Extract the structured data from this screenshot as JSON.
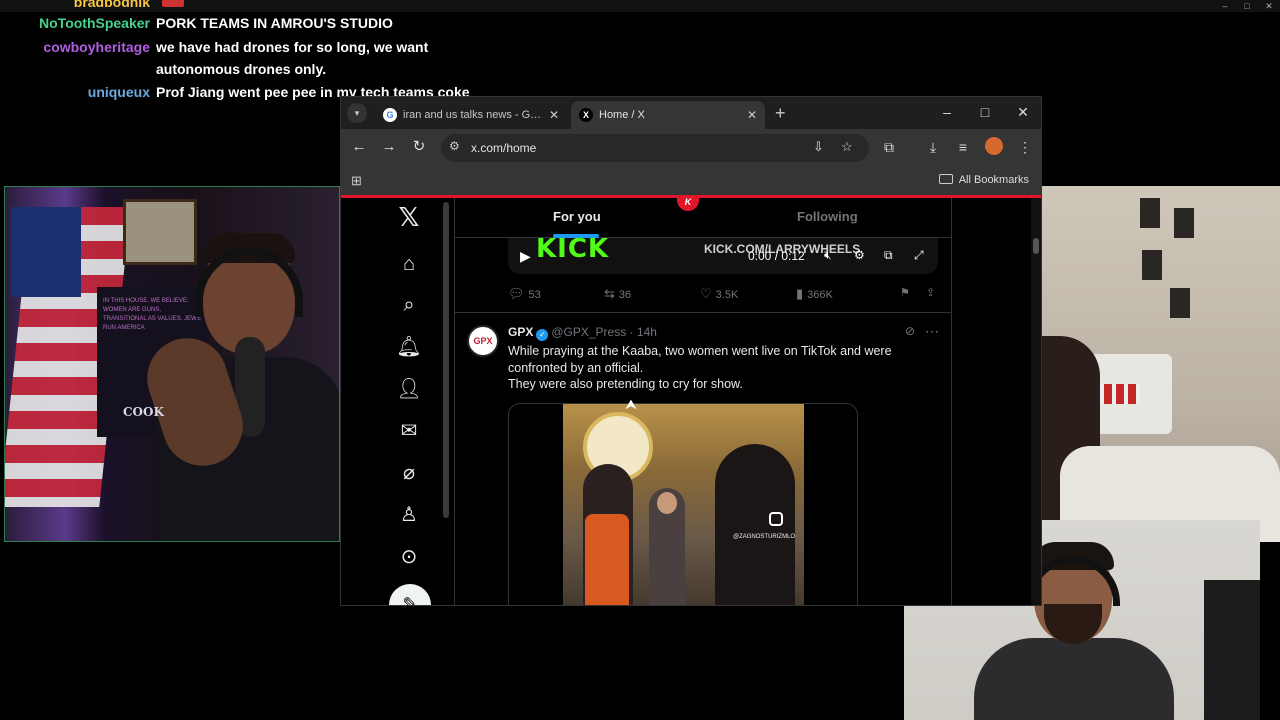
{
  "chat": [
    {
      "user": "bradbodnik",
      "message": "",
      "color": "#f5c542"
    },
    {
      "user": "NoToothSpeaker",
      "message": "PORK TEAMS IN AMROU'S STUDIO",
      "color": "#47d18c"
    },
    {
      "user": "cowboyheritage",
      "message": "we have had drones for so long, we want",
      "message2": "autonomous drones only.",
      "color": "#b05fe0"
    },
    {
      "user": "uniqueux",
      "message": "Prof Jiang went pee pee in my tech teams coke",
      "color": "#6fa8dc"
    }
  ],
  "webcam_left": {
    "shirt_text": "COOK",
    "poster_text": "IN THIS HOUSE, WE BELIEVE: WOMEN ARE GUNS, TRANSITIONAL AS VALUES, JEWS RUN AMERICA"
  },
  "browser": {
    "tabs": [
      {
        "title": "iran and us talks news - Google",
        "favicon": "G",
        "favicon_color": "#4285f4"
      },
      {
        "title": "Home / X",
        "favicon": "X",
        "favicon_color": "#ffffff"
      }
    ],
    "url": "x.com/home",
    "all_bookmarks": "All Bookmarks"
  },
  "x": {
    "tabs": {
      "for_you": "For you",
      "following": "Following"
    },
    "video": {
      "logo": "KICK",
      "url": "KICK.COM/LARRYWHEELS",
      "time": "0:00 / 0:12"
    },
    "actions": {
      "replies": "53",
      "reposts": "36",
      "likes": "3.5K",
      "views": "366K"
    },
    "tweet": {
      "name": "GPX",
      "handle": "@GPX_Press",
      "time": "14h",
      "avatar_text": "GPX",
      "text1": "While praying at the Kaaba, two women went live on TikTok and were confronted by an official.",
      "text2": "They were also pretending to cry for show.",
      "media_tag": "@ZAGNOSTURIZMLO"
    },
    "accent": "#1d9bf0"
  }
}
